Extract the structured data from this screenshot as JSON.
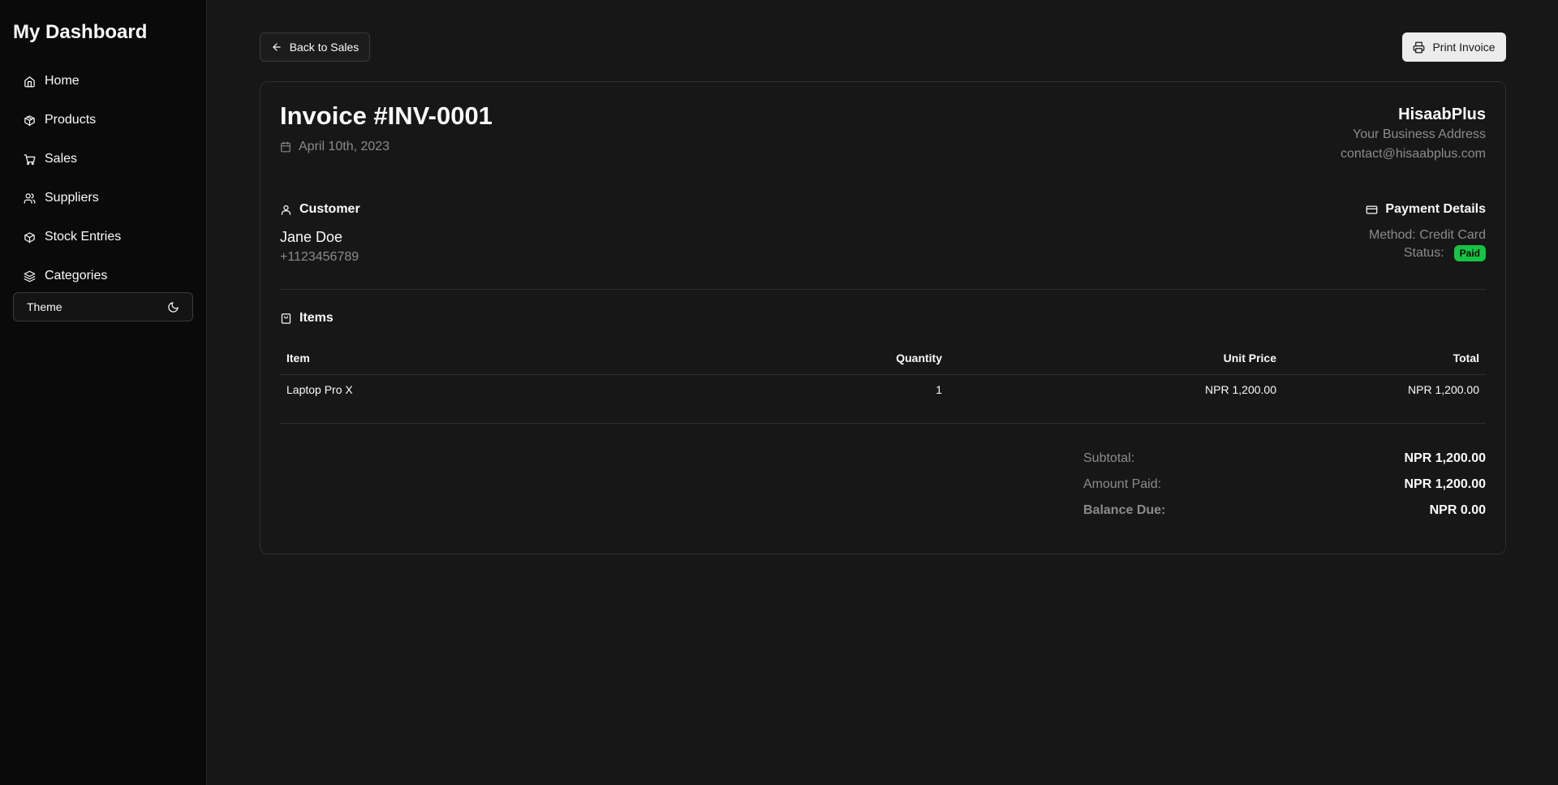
{
  "sidebar": {
    "brand": "My Dashboard",
    "items": [
      {
        "label": "Home",
        "icon": "home-icon"
      },
      {
        "label": "Products",
        "icon": "package-icon"
      },
      {
        "label": "Sales",
        "icon": "cart-icon"
      },
      {
        "label": "Suppliers",
        "icon": "users-icon"
      },
      {
        "label": "Stock Entries",
        "icon": "package-icon"
      },
      {
        "label": "Categories",
        "icon": "layers-icon"
      }
    ],
    "theme_label": "Theme"
  },
  "toolbar": {
    "back_label": "Back to Sales",
    "print_label": "Print Invoice"
  },
  "invoice": {
    "title": "Invoice #INV-0001",
    "date": "April 10th, 2023",
    "company": {
      "name": "HisaabPlus",
      "address": "Your Business Address",
      "email": "contact@hisaabplus.com"
    },
    "customer": {
      "heading": "Customer",
      "name": "Jane Doe",
      "phone": "+1123456789"
    },
    "payment": {
      "heading": "Payment Details",
      "method": "Method: Credit Card",
      "status_label": "Status:",
      "status": "Paid"
    },
    "items_heading": "Items",
    "columns": [
      "Item",
      "Quantity",
      "Unit Price",
      "Total"
    ],
    "rows": [
      {
        "item": "Laptop Pro X",
        "quantity": "1",
        "unit_price": "NPR 1,200.00",
        "total": "NPR 1,200.00"
      }
    ],
    "totals": {
      "subtotal_label": "Subtotal:",
      "subtotal": "NPR 1,200.00",
      "paid_label": "Amount Paid:",
      "paid": "NPR 1,200.00",
      "balance_label": "Balance Due:",
      "balance": "NPR 0.00"
    }
  },
  "colors": {
    "background": "#171717",
    "sidebar": "#0a0a0a",
    "muted_text": "#8b8b8b",
    "paid_badge": "#16c443",
    "print_button": "#ececec"
  }
}
